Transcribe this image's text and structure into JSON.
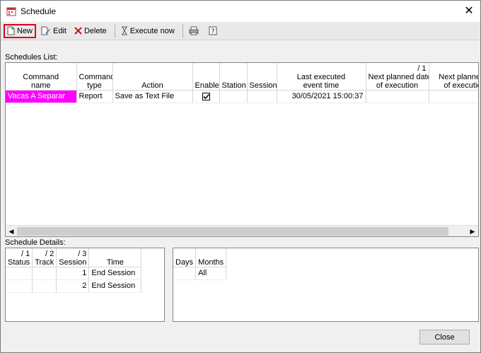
{
  "window": {
    "title": "Schedule"
  },
  "toolbar": {
    "new_label": "New",
    "edit_label": "Edit",
    "delete_label": "Delete",
    "execute_label": "Execute now"
  },
  "schedules": {
    "label": "Schedules List:",
    "columns": [
      {
        "num": "",
        "lines": [
          "Command",
          "name"
        ]
      },
      {
        "num": "",
        "lines": [
          "Command",
          "type"
        ]
      },
      {
        "num": "",
        "lines": [
          "Action"
        ]
      },
      {
        "num": "",
        "lines": [
          "Enable"
        ]
      },
      {
        "num": "",
        "lines": [
          "Station"
        ]
      },
      {
        "num": "",
        "lines": [
          "Session"
        ]
      },
      {
        "num": "",
        "lines": [
          "Last executed",
          "event time"
        ]
      },
      {
        "num": "/ 1",
        "lines": [
          "Next planned date",
          "of execution"
        ]
      },
      {
        "num": "/",
        "lines": [
          "Next planned ti",
          "of execution"
        ]
      }
    ],
    "rows": [
      {
        "command_name": "Vacas A Separar",
        "command_type": "Report",
        "action": "Save as Text File",
        "enabled": true,
        "station": "",
        "session": "",
        "last_executed": "30/05/2021 15:00:37",
        "next_date": "",
        "next_time": ""
      }
    ]
  },
  "details": {
    "label": "Schedule Details:",
    "columns": [
      {
        "num": "/ 1",
        "label": "Status"
      },
      {
        "num": "/ 2",
        "label": "Track"
      },
      {
        "num": "/ 3",
        "label": "Session"
      },
      {
        "num": "",
        "label": "Time"
      }
    ],
    "rows": [
      {
        "status": "",
        "track": "",
        "session": "1",
        "time": "End Session"
      },
      {
        "status": "",
        "track": "",
        "session": "2",
        "time": "End Session"
      }
    ]
  },
  "days_months": {
    "columns": [
      "Days",
      "Months"
    ],
    "rows": [
      {
        "days": "",
        "months": "All"
      }
    ]
  },
  "footer": {
    "close_label": "Close"
  },
  "colors": {
    "highlight": "#ff00ff",
    "new_button_outline": "#e0001b"
  }
}
